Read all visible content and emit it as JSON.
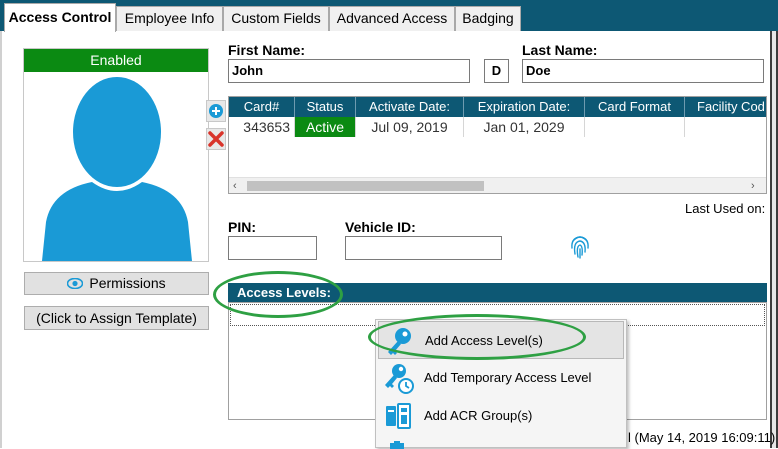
{
  "tabs": [
    {
      "label": "Access Control",
      "active": true
    },
    {
      "label": "Employee Info",
      "active": false
    },
    {
      "label": "Custom Fields",
      "active": false
    },
    {
      "label": "Advanced Access",
      "active": false
    },
    {
      "label": "Badging",
      "active": false
    }
  ],
  "photo": {
    "status": "Enabled"
  },
  "buttons": {
    "permissions": "Permissions",
    "assign_template": "(Click to Assign Template)"
  },
  "name": {
    "first_label": "First Name:",
    "first_value": "John",
    "middle_value": "D",
    "last_label": "Last Name:",
    "last_value": "Doe"
  },
  "cards": {
    "columns": [
      "Card#",
      "Status",
      "Activate Date:",
      "Expiration Date:",
      "Card Format",
      "Facility Cod"
    ],
    "rows": [
      {
        "card": "343653",
        "status": "Active",
        "activate": "Jul 09, 2019",
        "expiration": "Jan 01, 2029",
        "format": "",
        "facility": ""
      }
    ]
  },
  "last_used_label": "Last Used on:",
  "pin": {
    "label": "PIN:",
    "value": ""
  },
  "vehicle": {
    "label": "Vehicle ID:",
    "value": ""
  },
  "access_levels": {
    "header": "Access Levels:"
  },
  "context_menu": [
    {
      "label": "Add Access Level(s)",
      "icon": "key-icon",
      "highlighted": true
    },
    {
      "label": "Add Temporary Access Level",
      "icon": "key-clock-icon",
      "highlighted": false
    },
    {
      "label": "Add ACR Group(s)",
      "icon": "acr-group-icon",
      "highlighted": false
    }
  ],
  "footer_timestamp": "l (May 14, 2019  16:09:11)",
  "colors": {
    "header_blue": "#0d5874",
    "enabled_green": "#0b8a12",
    "active_green": "#0b8a12",
    "annotation_green": "#2ea043",
    "accent_blue": "#1a9ad6"
  }
}
